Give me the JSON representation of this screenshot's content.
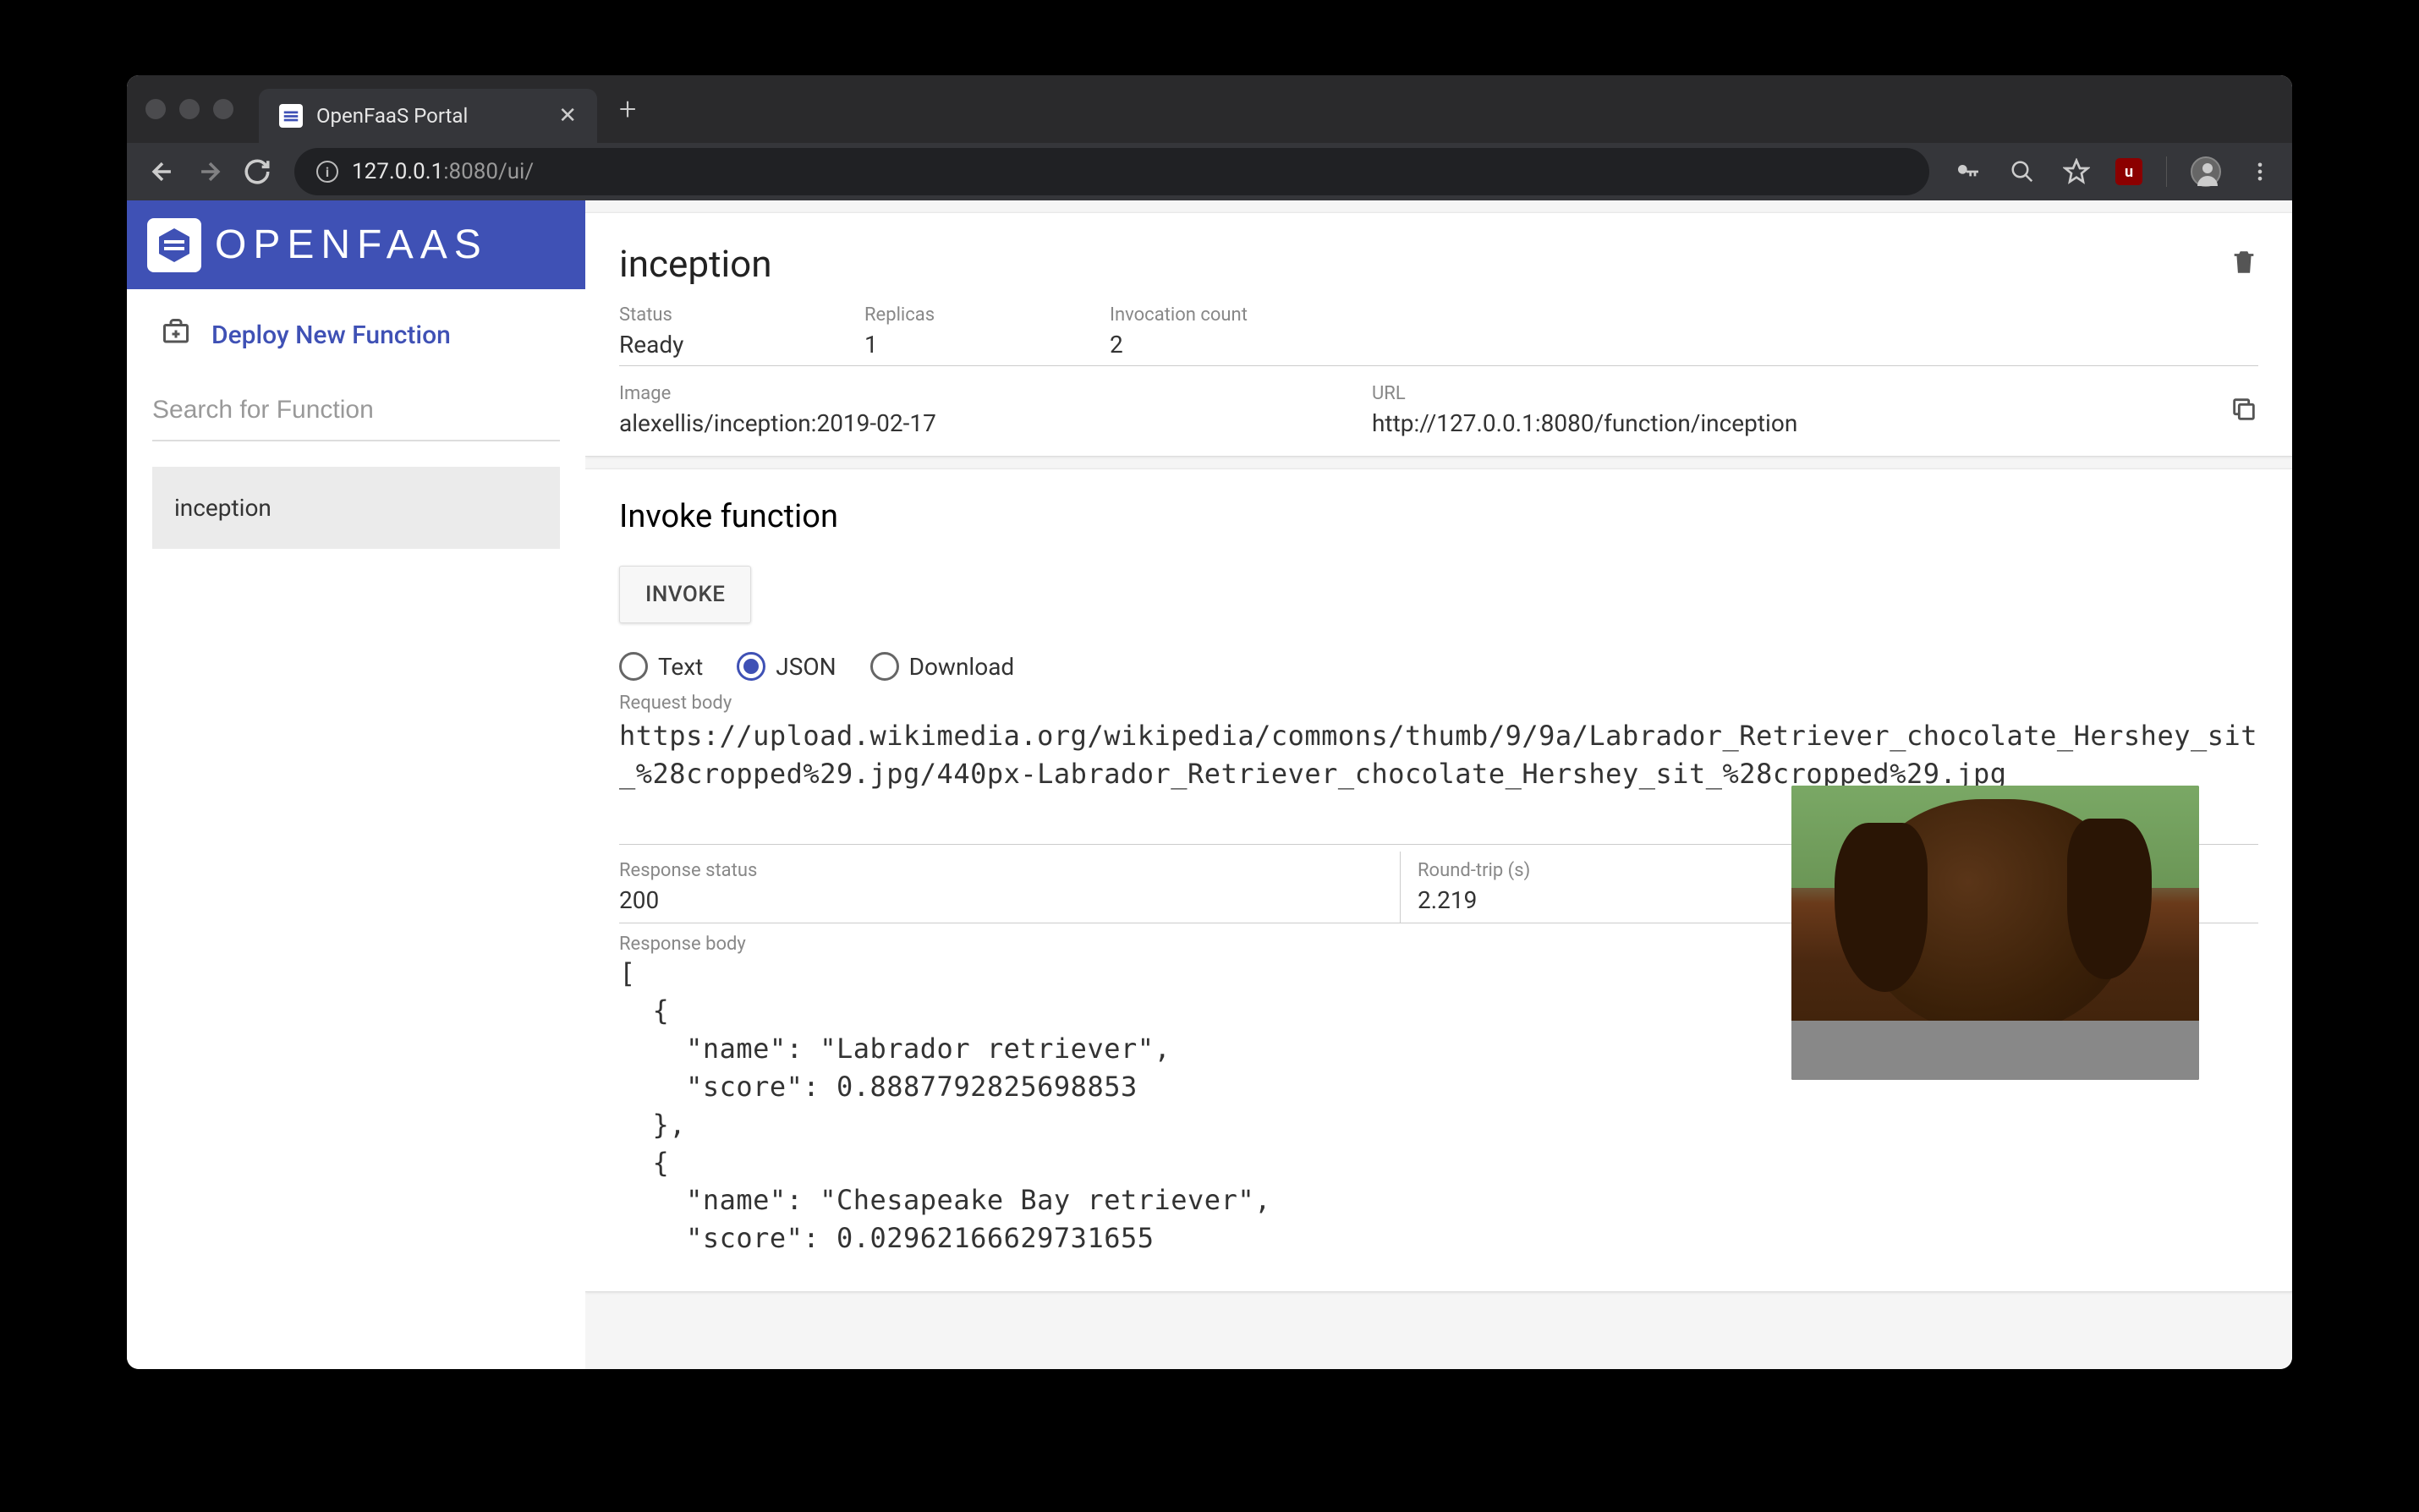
{
  "browser": {
    "tab_title": "OpenFaaS Portal",
    "url_host": "127.0.0.1",
    "url_port": ":8080",
    "url_path": "/ui/"
  },
  "sidebar": {
    "logo_text": "OPENFAAS",
    "deploy_label": "Deploy New Function",
    "search_placeholder": "Search for Function",
    "functions": [
      {
        "name": "inception"
      }
    ]
  },
  "function": {
    "name": "inception",
    "stats": {
      "status_label": "Status",
      "status_value": "Ready",
      "replicas_label": "Replicas",
      "replicas_value": "1",
      "invocation_label": "Invocation count",
      "invocation_value": "2",
      "image_label": "Image",
      "image_value": "alexellis/inception:2019-02-17",
      "url_label": "URL",
      "url_value": "http://127.0.0.1:8080/function/inception"
    }
  },
  "invoke": {
    "title": "Invoke function",
    "button_label": "INVOKE",
    "radios": {
      "text": "Text",
      "json": "JSON",
      "download": "Download",
      "selected": "json"
    },
    "request_body_label": "Request body",
    "request_body": "https://upload.wikimedia.org/wikipedia/commons/thumb/9/9a/Labrador_Retriever_chocolate_Hershey_sit_%28cropped%29.jpg/440px-Labrador_Retriever_chocolate_Hershey_sit_%28cropped%29.jpg",
    "response_status_label": "Response status",
    "response_status_value": "200",
    "roundtrip_label": "Round-trip (s)",
    "roundtrip_value": "2.219",
    "response_body_label": "Response body",
    "response_body": "[\n  {\n    \"name\": \"Labrador retriever\",\n    \"score\": 0.8887792825698853\n  },\n  {\n    \"name\": \"Chesapeake Bay retriever\",\n    \"score\": 0.02962166629731655"
  }
}
